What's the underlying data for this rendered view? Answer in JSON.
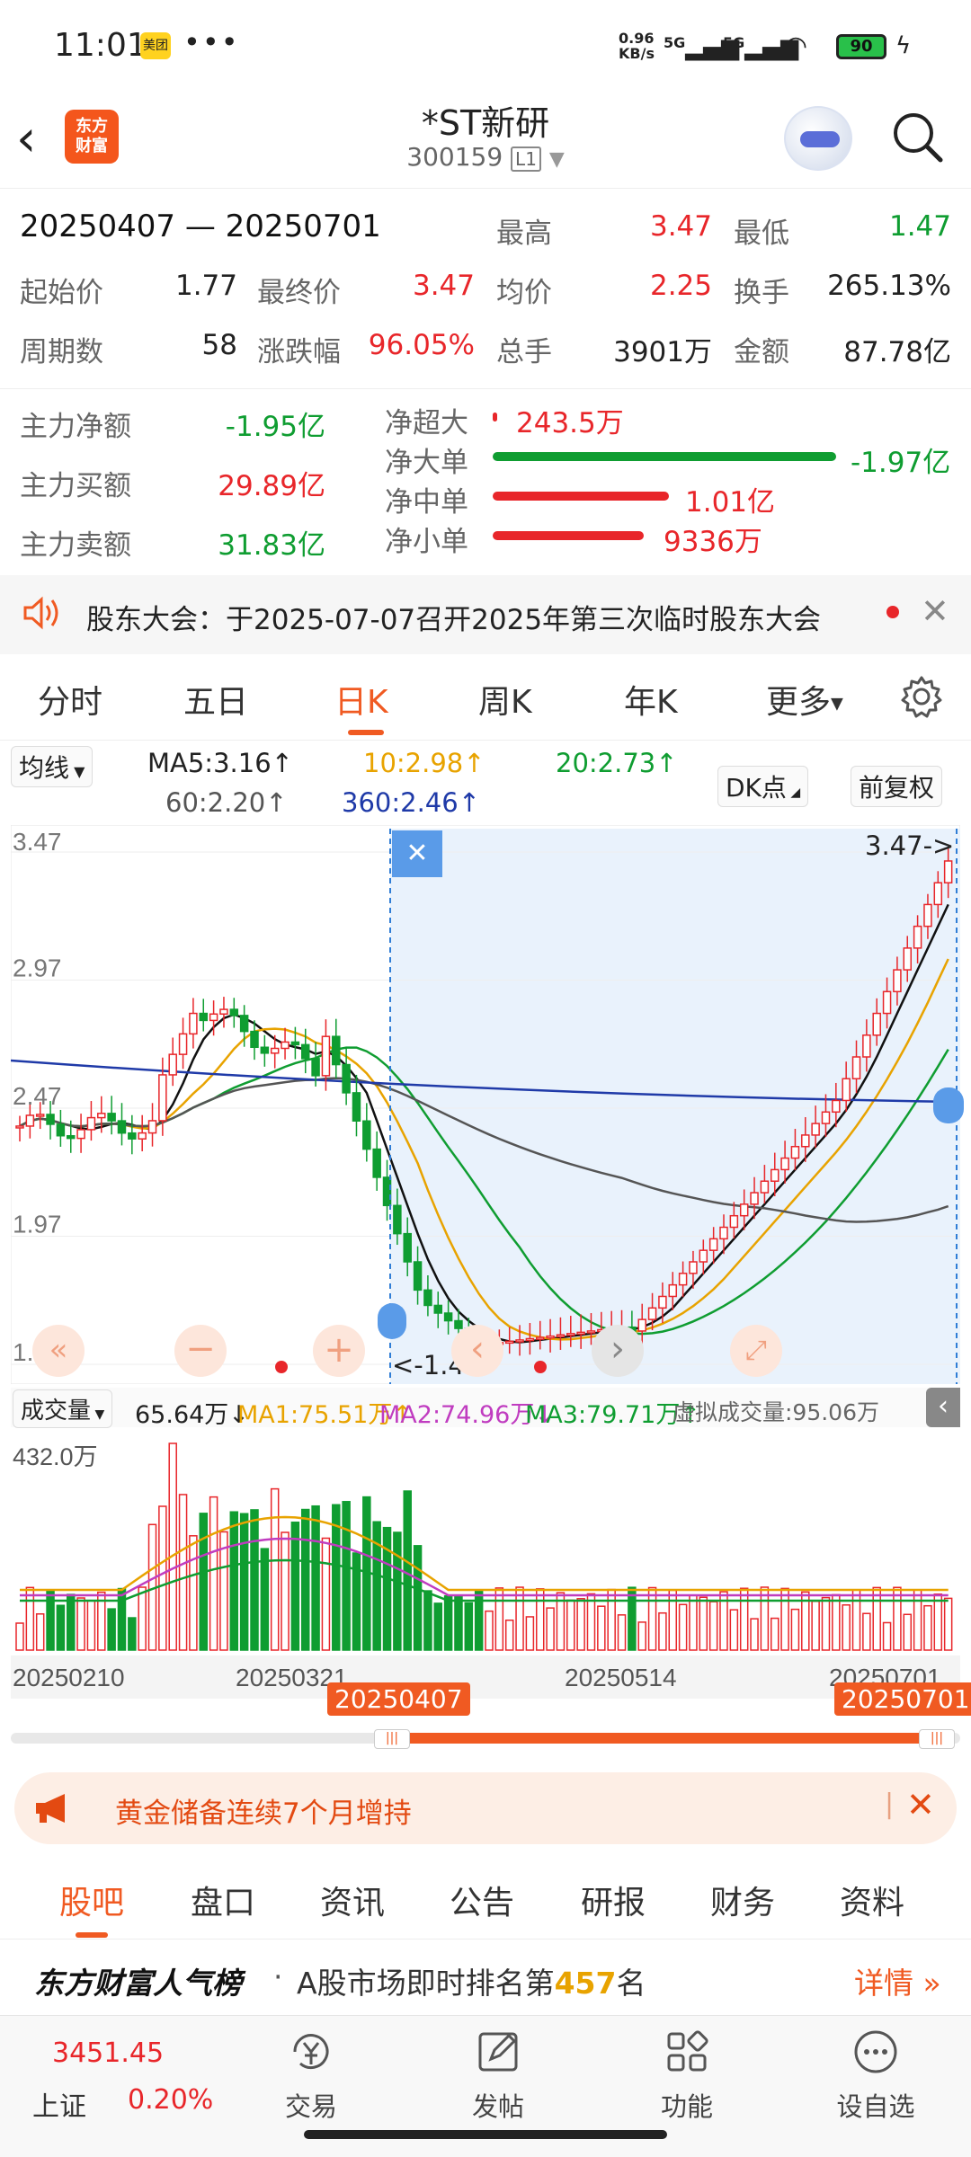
{
  "status_bar": {
    "time": "11:01",
    "app_badge": "美团",
    "more": "•••",
    "net_speed_top": "0.96",
    "net_speed_bottom": "KB/s",
    "signal1": "5G",
    "signal2": "5G",
    "battery": "90"
  },
  "header": {
    "logo_line1": "东方",
    "logo_line2": "财富",
    "title": "*ST新研",
    "code": "300159",
    "level": "L1"
  },
  "stats": {
    "range": "20250407 — 20250701",
    "high_label": "最高",
    "high": "3.47",
    "low_label": "最低",
    "low": "1.47",
    "start_label": "起始价",
    "start": "1.77",
    "end_label": "最终价",
    "end": "3.47",
    "avg_label": "均价",
    "avg": "2.25",
    "turnover_label": "换手",
    "turnover": "265.13%",
    "periods_label": "周期数",
    "periods": "58",
    "change_label": "涨跌幅",
    "change": "96.05%",
    "volume_label": "总手",
    "volume": "3901万",
    "amount_label": "金额",
    "amount": "87.78亿"
  },
  "flow": {
    "net_label": "主力净额",
    "net": "-1.95亿",
    "buy_label": "主力买额",
    "buy": "29.89亿",
    "sell_label": "主力卖额",
    "sell": "31.83亿",
    "super_label": "净超大",
    "super": "243.5万",
    "large_label": "净大单",
    "large": "-1.97亿",
    "medium_label": "净中单",
    "medium": "1.01亿",
    "small_label": "净小单",
    "small": "9336万",
    "colors": {
      "red": "#e8262a",
      "green": "#0f9d31"
    }
  },
  "notice": {
    "text": "股东大会：于2025-07-07召开2025年第三次临时股东大会"
  },
  "tabs": {
    "items": [
      "分时",
      "五日",
      "日K",
      "周K",
      "年K",
      "更多"
    ],
    "active": "日K"
  },
  "ma": {
    "selector": "均线",
    "ma5": "MA5:3.16↑",
    "ma10": "10:2.98↑",
    "ma20": "20:2.73↑",
    "ma60": "60:2.20↑",
    "ma360": "360:2.46↑",
    "dk": "DK点",
    "adjust": "前复权"
  },
  "chart": {
    "y_labels": [
      "3.47",
      "2.97",
      "2.47",
      "1.97",
      "1.47"
    ],
    "high_marker": "3.47->",
    "low_marker": "<-1.47",
    "close_x": "✕"
  },
  "volume": {
    "selector": "成交量",
    "vol": "65.64万↓",
    "ma1": "MA1:75.51万↑",
    "ma2": "MA2:74.96万↓",
    "ma3": "MA3:79.71万↑",
    "virtual": "虚拟成交量:95.06万",
    "max_label": "432.0万",
    "x_labels": [
      "20250210",
      "20250321",
      "20250514",
      "20250701"
    ]
  },
  "slider": {
    "start_tag": "20250407",
    "end_tag": "20250701"
  },
  "ad": {
    "text": "黄金储备连续7个月增持"
  },
  "bottom_tabs": {
    "items": [
      "股吧",
      "盘口",
      "资讯",
      "公告",
      "研报",
      "财务",
      "资料"
    ],
    "active": "股吧"
  },
  "rank": {
    "brand": "东方财富人气榜",
    "dot": "·",
    "text_prefix": "A股市场即时排名第",
    "rank": "457",
    "text_suffix": "名",
    "detail": "详情"
  },
  "nav": {
    "index_value": "3451.45",
    "index_name": "上证",
    "index_change": "0.20%",
    "items": [
      "交易",
      "发帖",
      "功能",
      "设自选"
    ]
  }
}
